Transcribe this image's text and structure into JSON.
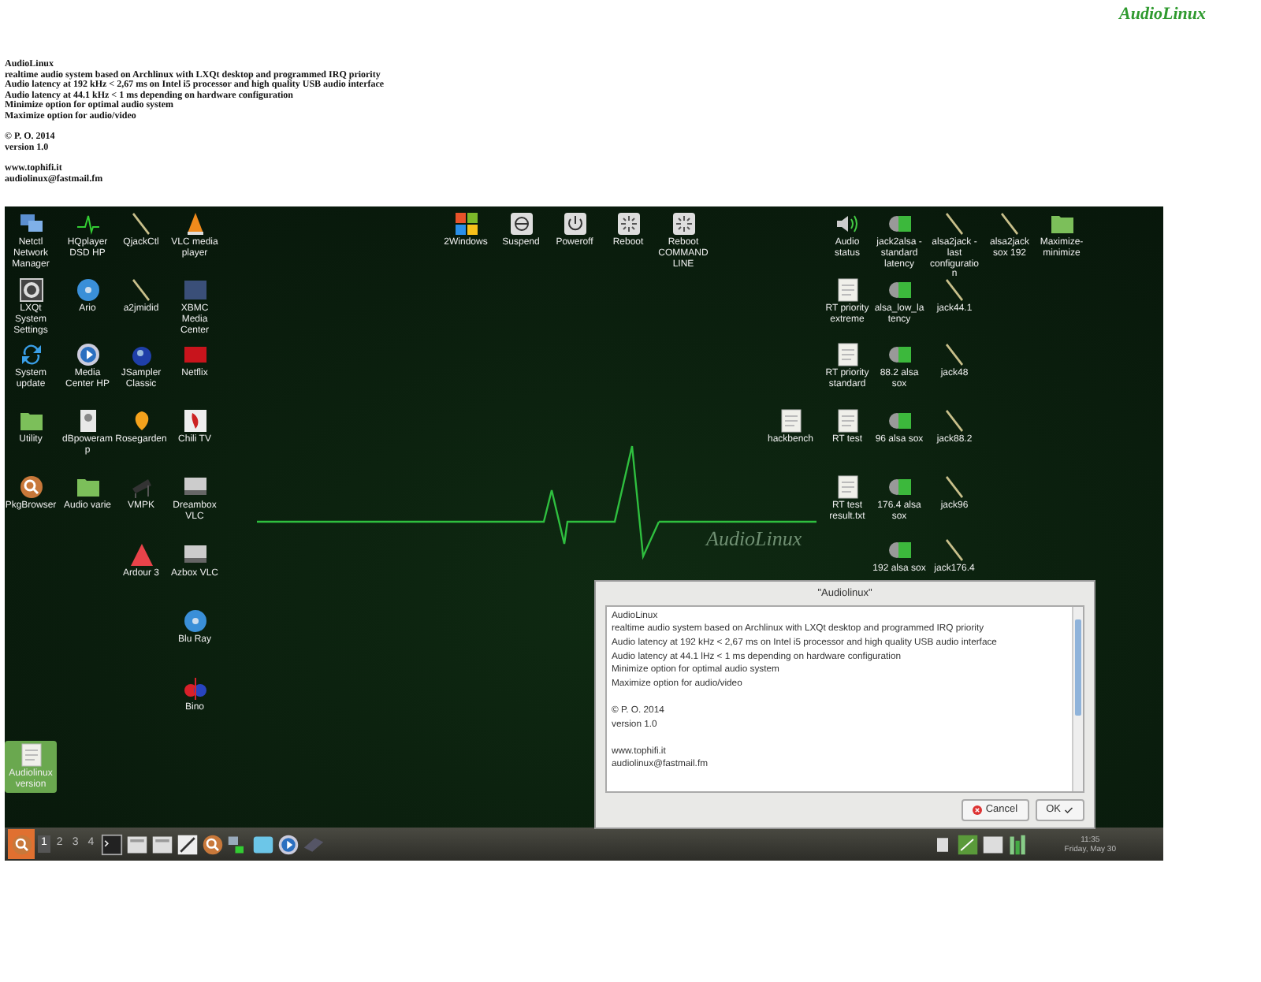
{
  "logo": "AudioLinux",
  "header": {
    "paragraphs": [
      [
        "AudioLinux",
        "realtime audio system based on Archlinux with LXQt desktop and programmed IRQ priority",
        "Audio latency at 192 kHz < 2,67 ms on Intel i5 processor and high quality USB audio interface",
        "Audio latency at 44.1 kHz < 1 ms depending on hardware configuration",
        "Minimize option for optimal audio system",
        "Maximize option for audio/video"
      ],
      [
        "© P. O. 2014",
        "version 1.0"
      ],
      [
        "www.tophifi.it",
        "audiolinux@fastmail.fm"
      ]
    ]
  },
  "desktop": {
    "wallpaper_text": "AudioLinux",
    "left_icons": [
      {
        "label": "Netctl Network Manager",
        "kind": "monitor",
        "selected": false
      },
      {
        "label": "HQplayer DSD HP",
        "kind": "wave",
        "selected": false
      },
      {
        "label": "QjackCtl",
        "kind": "quill",
        "selected": false
      },
      {
        "label": "VLC media player",
        "kind": "cone",
        "selected": false
      },
      {
        "label": "LXQt System Settings",
        "kind": "gear",
        "selected": false
      },
      {
        "label": "Ario",
        "kind": "disc",
        "selected": false
      },
      {
        "label": "a2jmidid",
        "kind": "quill",
        "selected": false
      },
      {
        "label": "XBMC Media Center",
        "kind": "tile",
        "selected": false
      },
      {
        "label": "System update",
        "kind": "sync",
        "selected": false
      },
      {
        "label": "Media Center HP",
        "kind": "play",
        "selected": false
      },
      {
        "label": "JSampler Classic",
        "kind": "orb",
        "selected": false
      },
      {
        "label": "Netflix",
        "kind": "redtile",
        "selected": false
      },
      {
        "label": "Utility",
        "kind": "folder",
        "selected": false
      },
      {
        "label": "dBpoweramp",
        "kind": "portrait",
        "selected": false
      },
      {
        "label": "Rosegarden",
        "kind": "flower",
        "selected": false
      },
      {
        "label": "Chili TV",
        "kind": "pepper",
        "selected": false
      },
      {
        "label": "PkgBrowser",
        "kind": "magnifier",
        "selected": false
      },
      {
        "label": "Audio varie",
        "kind": "folder",
        "selected": false
      },
      {
        "label": "VMPK",
        "kind": "piano",
        "selected": false
      },
      {
        "label": "Dreambox VLC",
        "kind": "device",
        "selected": false
      },
      {
        "label": "Ardour 3",
        "kind": "triangle",
        "selected": false
      },
      {
        "label": "Azbox VLC",
        "kind": "device",
        "selected": false
      },
      {
        "label": "Blu Ray",
        "kind": "disc",
        "selected": false
      },
      {
        "label": "Bino",
        "kind": "split",
        "selected": false
      },
      {
        "label": "Audiolinux version",
        "kind": "document",
        "selected": true
      }
    ],
    "top_icons": [
      {
        "label": "2Windows",
        "kind": "windows",
        "selected": false
      },
      {
        "label": "Suspend",
        "kind": "suspend",
        "selected": false
      },
      {
        "label": "Poweroff",
        "kind": "power",
        "selected": false
      },
      {
        "label": "Reboot",
        "kind": "reboot",
        "selected": false
      },
      {
        "label": "Reboot COMMAND LINE",
        "kind": "reboot",
        "selected": false
      }
    ],
    "right_icons": [
      {
        "label": "Audio status",
        "kind": "speaker",
        "selected": false
      },
      {
        "label": "jack2alsa - standard latency",
        "kind": "audiofile",
        "selected": false
      },
      {
        "label": "alsa2jack - last configuration",
        "kind": "quill",
        "selected": false
      },
      {
        "label": "alsa2jack sox 192",
        "kind": "quill",
        "selected": false
      },
      {
        "label": "Maximize-minimize",
        "kind": "folder",
        "selected": false
      },
      {
        "label": "RT priority extreme",
        "kind": "document",
        "selected": false
      },
      {
        "label": "alsa_low_latency",
        "kind": "audiofile",
        "selected": false
      },
      {
        "label": "jack44.1",
        "kind": "quill",
        "selected": false
      },
      {
        "label": "RT priority standard",
        "kind": "document",
        "selected": false
      },
      {
        "label": "88.2 alsa sox",
        "kind": "audiofile",
        "selected": false
      },
      {
        "label": "jack48",
        "kind": "quill",
        "selected": false
      },
      {
        "label": "hackbench",
        "kind": "document",
        "selected": false
      },
      {
        "label": "RT test",
        "kind": "document",
        "selected": false
      },
      {
        "label": "96 alsa sox",
        "kind": "audiofile",
        "selected": false
      },
      {
        "label": "jack88.2",
        "kind": "quill",
        "selected": false
      },
      {
        "label": "RT test result.txt",
        "kind": "document",
        "selected": false
      },
      {
        "label": "176.4 alsa sox",
        "kind": "audiofile",
        "selected": false
      },
      {
        "label": "jack96",
        "kind": "quill",
        "selected": false
      },
      {
        "label": "192 alsa sox",
        "kind": "audiofile",
        "selected": false
      },
      {
        "label": "jack176.4",
        "kind": "quill",
        "selected": false
      }
    ]
  },
  "dialog": {
    "title": "\"Audiolinux\"",
    "paragraphs": [
      [
        "AudioLinux",
        "realtime audio system based on Archlinux with LXQt desktop and programmed IRQ priority",
        "Audio latency at 192 kHz < 2,67 ms on Intel i5 processor and high quality USB audio interface",
        "Audio latency at 44.1 lHz < 1 ms depending on hardware configuration",
        "Minimize option for optimal audio system",
        "Maximize option for audio/video"
      ],
      [
        "© P. O. 2014",
        "version 1.0"
      ],
      [
        "www.tophifi.it",
        "audiolinux@fastmail.fm"
      ]
    ],
    "buttons": [
      {
        "label": "Cancel",
        "kind": "cancel"
      },
      {
        "label": "OK",
        "kind": "ok"
      }
    ]
  },
  "taskbar": {
    "workspaces": [
      {
        "label": "1",
        "selected": true
      },
      {
        "label": "2",
        "selected": false
      },
      {
        "label": "3",
        "selected": false
      },
      {
        "label": "4",
        "selected": false
      }
    ],
    "launchers": [
      {
        "kind": "terminal"
      },
      {
        "kind": "files"
      },
      {
        "kind": "files"
      },
      {
        "kind": "editor"
      },
      {
        "kind": "magnifier"
      },
      {
        "kind": "network"
      },
      {
        "kind": "box"
      },
      {
        "kind": "play"
      },
      {
        "kind": "book"
      }
    ],
    "tray": [
      {
        "kind": "clipboard"
      },
      {
        "kind": "greenbox"
      },
      {
        "kind": "whitebox"
      },
      {
        "kind": "meter"
      }
    ],
    "time": "11:35",
    "date": "Friday, May 30"
  }
}
